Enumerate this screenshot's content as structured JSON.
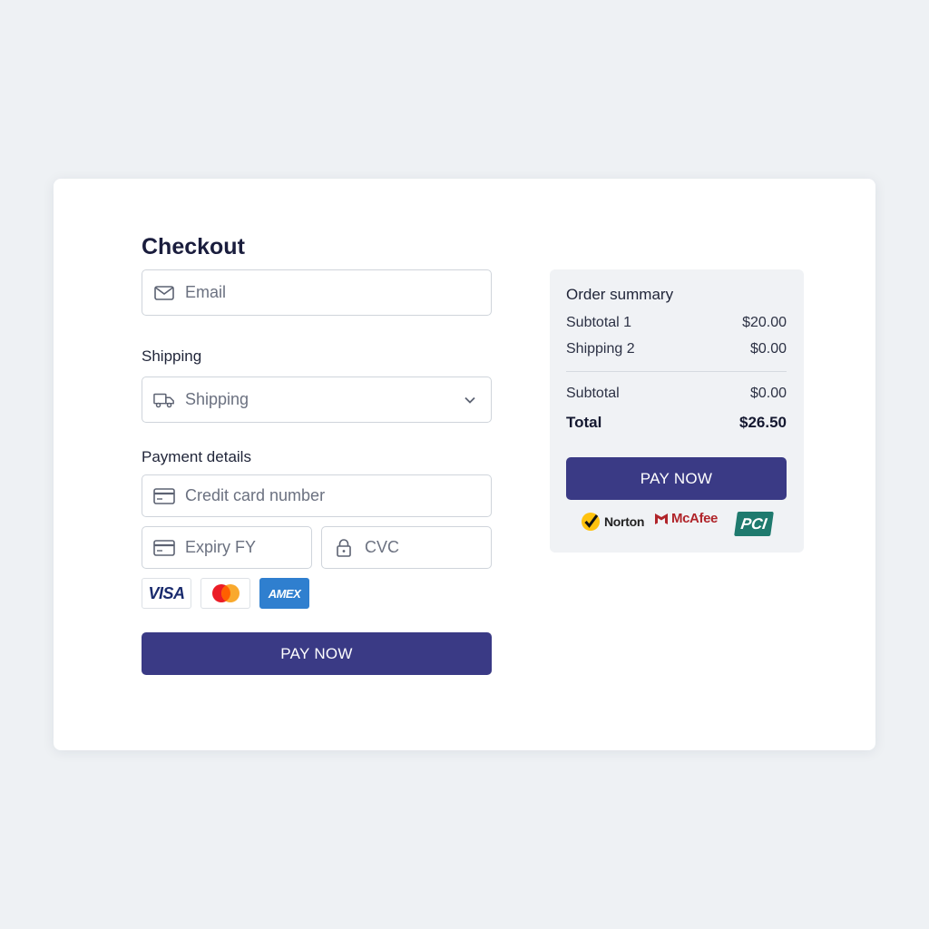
{
  "checkout": {
    "title": "Checkout",
    "email_placeholder": "Email",
    "shipping_label": "Shipping",
    "shipping_placeholder": "Shipping",
    "payment_label": "Payment details",
    "card_placeholder": "Credit card number",
    "expiry_placeholder": "Expiry FY",
    "cvc_placeholder": "CVC",
    "card_brands": [
      "VISA",
      "Mastercard",
      "AMEX"
    ],
    "pay_label": "PAY NOW"
  },
  "summary": {
    "title": "Order summary",
    "rows": [
      {
        "label": "Subtotal 1",
        "value": "$20.00"
      },
      {
        "label": "Shipping 2",
        "value": "$0.00"
      },
      {
        "label": "Subtotal",
        "value": "$0.00"
      }
    ],
    "total_label": "Total",
    "total_value": "$26.50",
    "pay_label": "PAY NOW",
    "trust_badges": [
      "Norton",
      "McAfee",
      "PCI"
    ]
  },
  "colors": {
    "background": "#eef1f4",
    "accent": "#3a3a85",
    "summary_panel": "#f0f2f5"
  },
  "icons": [
    "mail-icon",
    "truck-icon",
    "chevron-down-icon",
    "credit-card-icon",
    "lock-icon"
  ]
}
